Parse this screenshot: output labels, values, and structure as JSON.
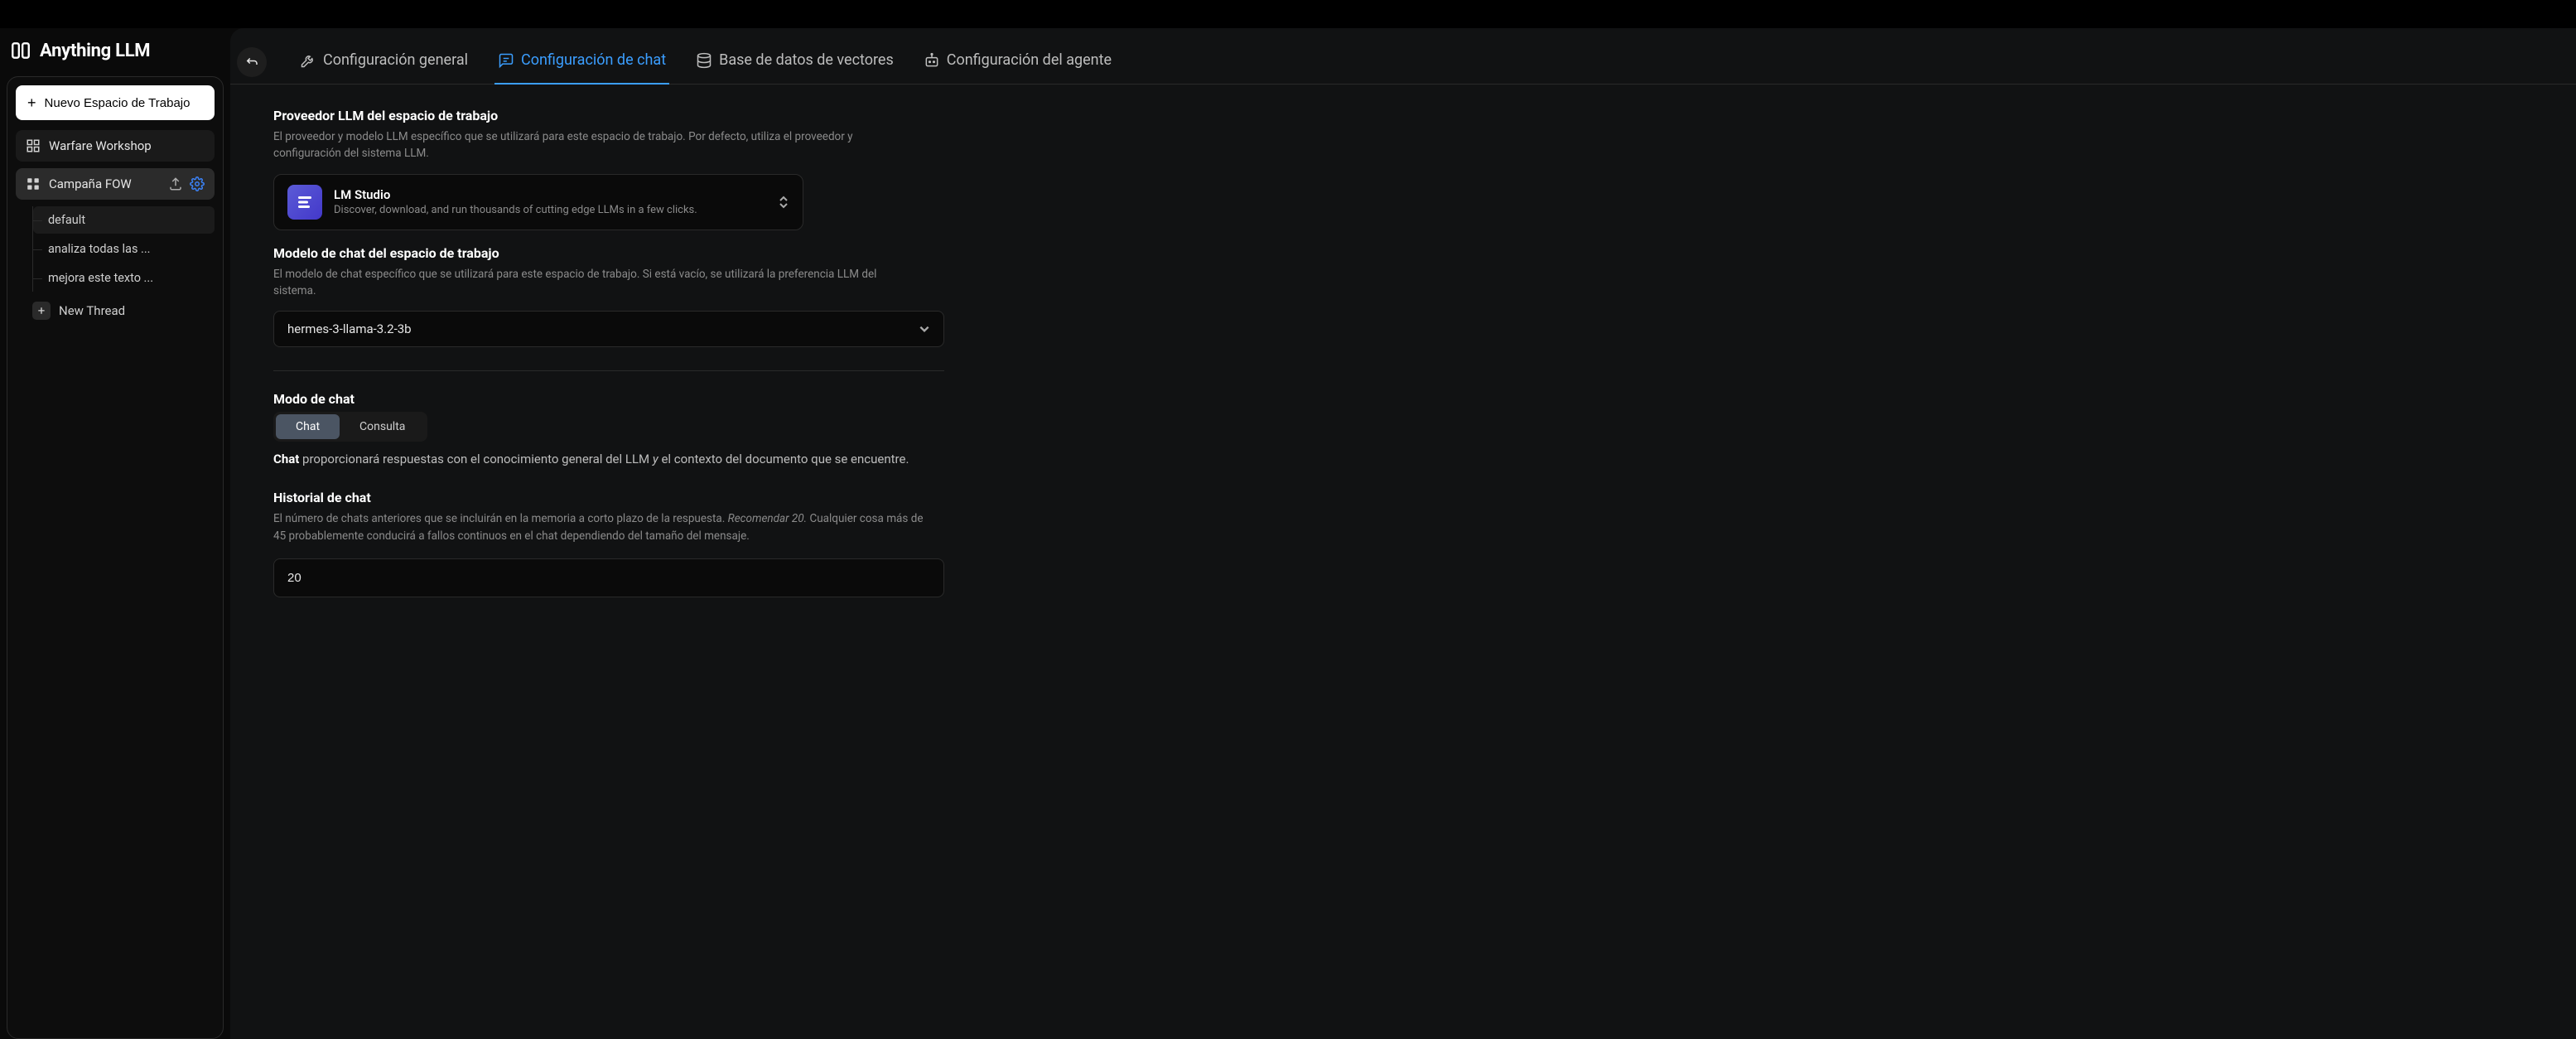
{
  "brand": {
    "name": "Anything LLM"
  },
  "sidebar": {
    "new_workspace_label": "Nuevo Espacio de Trabajo",
    "workspaces": [
      {
        "name": "Warfare Workshop"
      },
      {
        "name": "Campaña FOW"
      }
    ],
    "threads": [
      {
        "label": "default"
      },
      {
        "label": "analiza todas las ..."
      },
      {
        "label": "mejora este texto ..."
      }
    ],
    "new_thread_label": "New Thread"
  },
  "tabs": {
    "general": "Configuración general",
    "chat": "Configuración de chat",
    "vectordb": "Base de datos de vectores",
    "agent": "Configuración del agente"
  },
  "provider": {
    "title": "Proveedor LLM del espacio de trabajo",
    "desc": "El proveedor y modelo LLM específico que se utilizará para este espacio de trabajo. Por defecto, utiliza el proveedor y configuración del sistema LLM.",
    "selected_name": "LM Studio",
    "selected_sub": "Discover, download, and run thousands of cutting edge LLMs in a few clicks."
  },
  "model": {
    "title": "Modelo de chat del espacio de trabajo",
    "desc": "El modelo de chat específico que se utilizará para este espacio de trabajo. Si está vacío, se utilizará la preferencia LLM del sistema.",
    "value": "hermes-3-llama-3.2-3b"
  },
  "chatmode": {
    "title": "Modo de chat",
    "opt_chat": "Chat",
    "opt_query": "Consulta",
    "desc_bold": "Chat",
    "desc_part1": " proporcionará respuestas con el conocimiento general del LLM ",
    "desc_italic": "y",
    "desc_part2": " el contexto del documento que se encuentre."
  },
  "history": {
    "title": "Historial de chat",
    "desc_part1": "El número de chats anteriores que se incluirán en la memoria a corto plazo de la respuesta. ",
    "desc_rec": "Recomendar 20.",
    "desc_part2": " Cualquier cosa más de 45 probablemente conducirá a fallos continuos en el chat dependiendo del tamaño del mensaje.",
    "value": "20"
  }
}
